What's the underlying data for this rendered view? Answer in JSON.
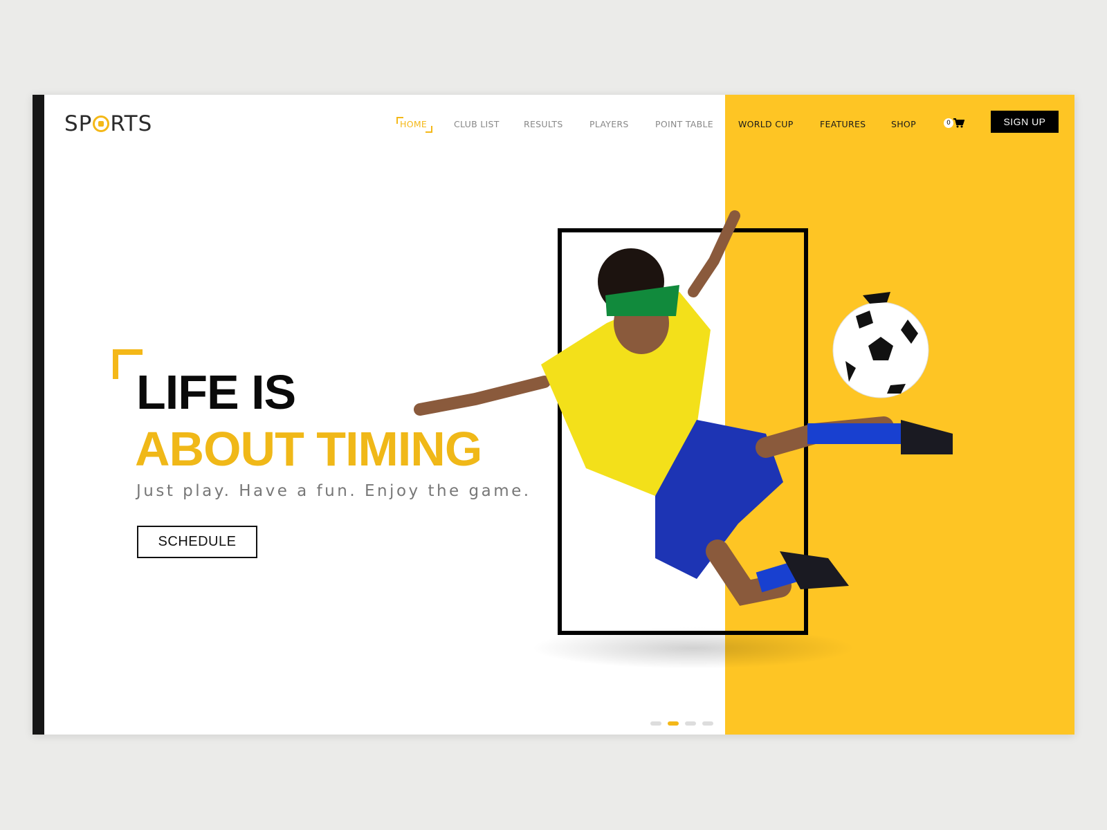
{
  "brand": {
    "logo_left": "SP",
    "logo_right": "RTS",
    "logo_full": "SPORTS"
  },
  "nav": {
    "items": [
      {
        "label": "HOME",
        "active": true
      },
      {
        "label": "CLUB LIST"
      },
      {
        "label": "RESULTS"
      },
      {
        "label": "PLAYERS"
      },
      {
        "label": "POINT TABLE"
      },
      {
        "label": "WORLD CUP"
      },
      {
        "label": "FEATURES"
      },
      {
        "label": "SHOP"
      }
    ],
    "cart_count": "0",
    "cart_icon": "shopping-cart-icon",
    "signup_label": "SIGN UP"
  },
  "hero": {
    "title_line1": "LIFE IS",
    "title_line2": "ABOUT TIMING",
    "subtitle": "Just play. Have a fun. Enjoy the game.",
    "cta_label": "SCHEDULE"
  },
  "slider": {
    "count": 4,
    "active_index": 1
  },
  "colors": {
    "accent": "#f4b818",
    "yellow_panel": "#fec524",
    "dark": "#161616"
  }
}
